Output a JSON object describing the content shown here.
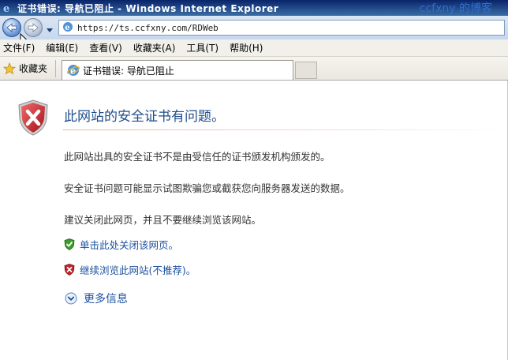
{
  "window": {
    "title": "证书错误: 导航已阻止 - Windows Internet Explorer",
    "watermark": "ccfxny 的博客"
  },
  "address_bar": {
    "url": "https://ts.ccfxny.com/RDWeb"
  },
  "menu": {
    "items": [
      {
        "label": "文件(F)"
      },
      {
        "label": "编辑(E)"
      },
      {
        "label": "查看(V)"
      },
      {
        "label": "收藏夹(A)"
      },
      {
        "label": "工具(T)"
      },
      {
        "label": "帮助(H)"
      }
    ]
  },
  "favorites": {
    "label": "收藏夹"
  },
  "tab": {
    "title": "证书错误: 导航已阻止"
  },
  "content": {
    "heading": "此网站的安全证书有问题。",
    "paragraph1": "此网站出具的安全证书不是由受信任的证书颁发机构颁发的。",
    "paragraph2": "安全证书问题可能显示试图欺骗您或截获您向服务器发送的数据。",
    "paragraph3": "建议关闭此网页，并且不要继续浏览该网站。",
    "close_link": "单击此处关闭该网页。",
    "continue_link": "继续浏览此网站(不推荐)。",
    "more_info": "更多信息"
  },
  "colors": {
    "heading": "#1f4e8c",
    "link": "#1a4f9e",
    "safe_shield": "#3c9a2e",
    "danger_shield": "#c0242a"
  }
}
